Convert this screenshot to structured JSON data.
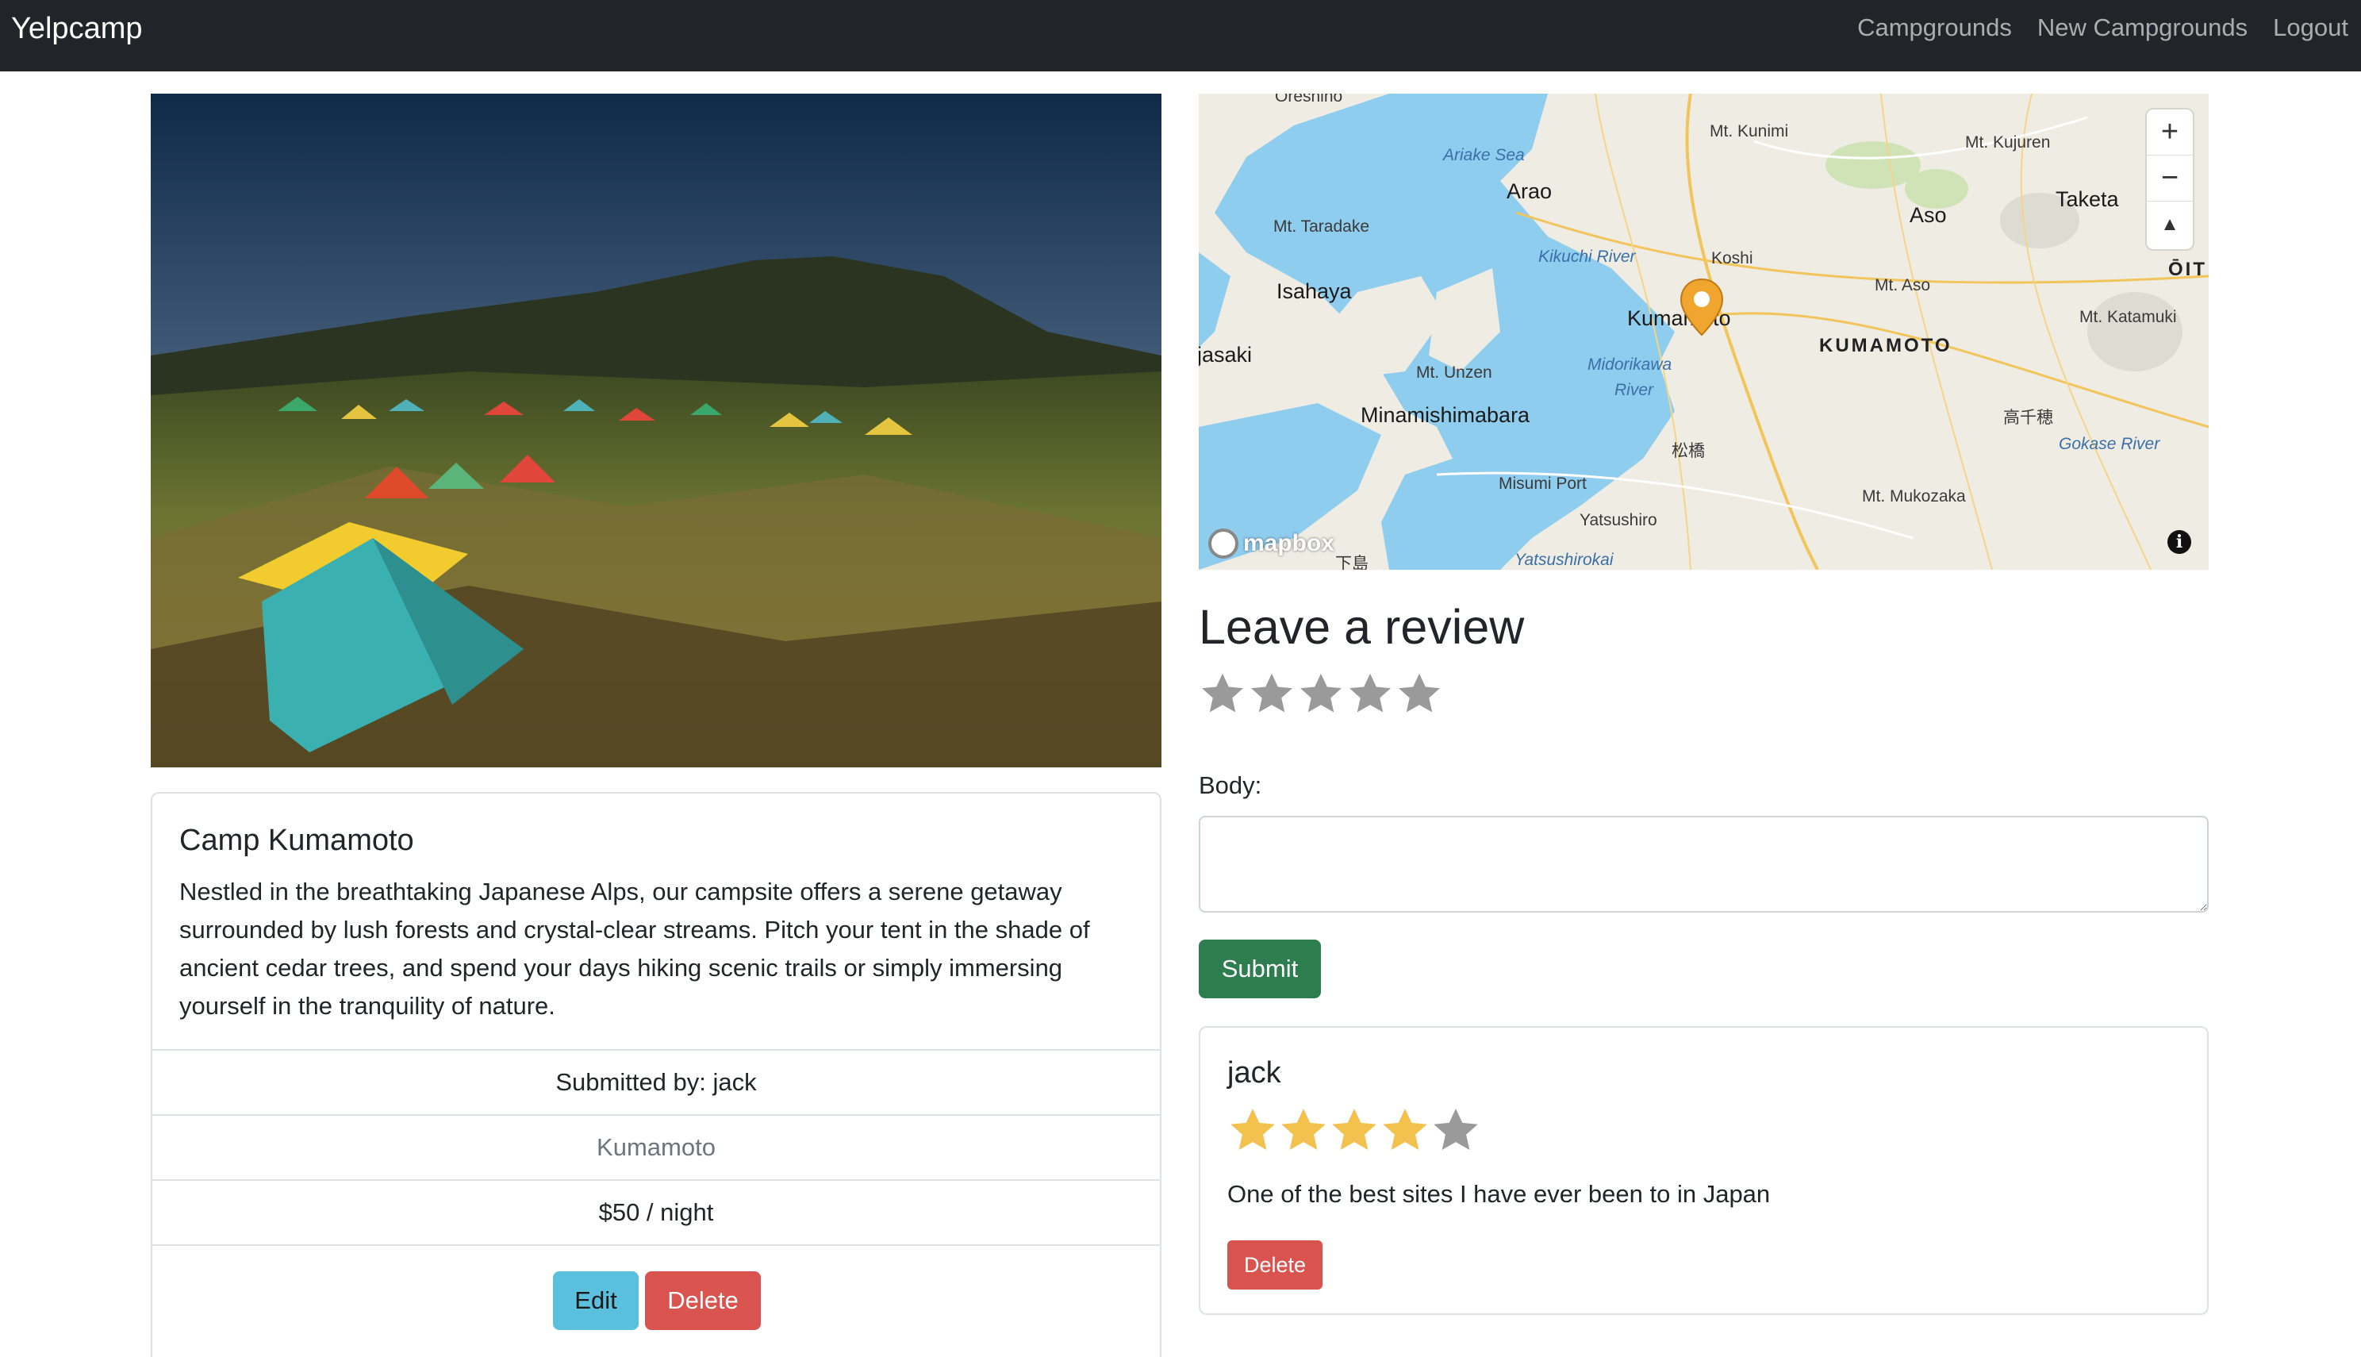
{
  "navbar": {
    "brand": "Yelpcamp",
    "links": [
      "Campgrounds",
      "New Campgrounds",
      "Logout"
    ]
  },
  "campground": {
    "image_alt": "camp-photo",
    "title": "Camp Kumamoto",
    "description": "Nestled in the breathtaking Japanese Alps, our campsite offers a serene getaway surrounded by lush forests and crystal-clear streams. Pitch your tent in the shade of ancient cedar trees, and spend your days hiking scenic trails or simply immersing yourself in the tranquility of nature.",
    "submitted_by": "Submitted by: jack",
    "location": "Kumamoto",
    "price": "$50 / night",
    "edit_label": "Edit",
    "delete_label": "Delete"
  },
  "map": {
    "labels": {
      "oreshino": "Oreshino",
      "ariake_sea": "Ariake Sea",
      "arao": "Arao",
      "mt_kunimi": "Mt. Kunimi",
      "mt_kujuren": "Mt. Kujuren",
      "taketa": "Taketa",
      "mt_taradake": "Mt. Taradake",
      "kikuchi_river": "Kikuchi River",
      "koshi": "Koshi",
      "aso": "Aso",
      "isahaya": "Isahaya",
      "mt_aso": "Mt. Aso",
      "oita": "ŌIT",
      "kumamoto_city": "Kumamoto",
      "mt_katamuki": "Mt. Katamuki",
      "isasaki": "jasaki",
      "kumamoto_region": "KUMAMOTO",
      "mt_unzen": "Mt. Unzen",
      "midorikawa": "Midorikawa",
      "river": "River",
      "minamishimabara": "Minamishimabara",
      "takachiho": "高千穂",
      "matsubase": "松橋",
      "gokase_river": "Gokase River",
      "misumi_port": "Misumi Port",
      "mt_mukozaka": "Mt. Mukozaka",
      "yatsushiro": "Yatsushiro",
      "yatsushirokai": "Yatsushirokai",
      "shimo": "下島",
      "mapbox": "mapbox"
    },
    "zoom_in": "+",
    "zoom_out": "−",
    "compass": "▲",
    "info": "i"
  },
  "review_form": {
    "heading": "Leave a review",
    "rating": 0,
    "max_rating": 5,
    "body_label": "Body:",
    "body_value": "",
    "submit_label": "Submit"
  },
  "reviews": [
    {
      "author": "jack",
      "rating": 4,
      "max_rating": 5,
      "text": "One of the best sites I have ever been to in Japan",
      "delete_label": "Delete"
    }
  ],
  "colors": {
    "navbar_bg": "#212529",
    "edit_btn": "#5bc0de",
    "delete_btn": "#d9534f",
    "submit_btn": "#2e7d4f",
    "star_filled": "#f2c14e",
    "star_empty": "#9a9a9a",
    "water": "#8fcdee"
  }
}
